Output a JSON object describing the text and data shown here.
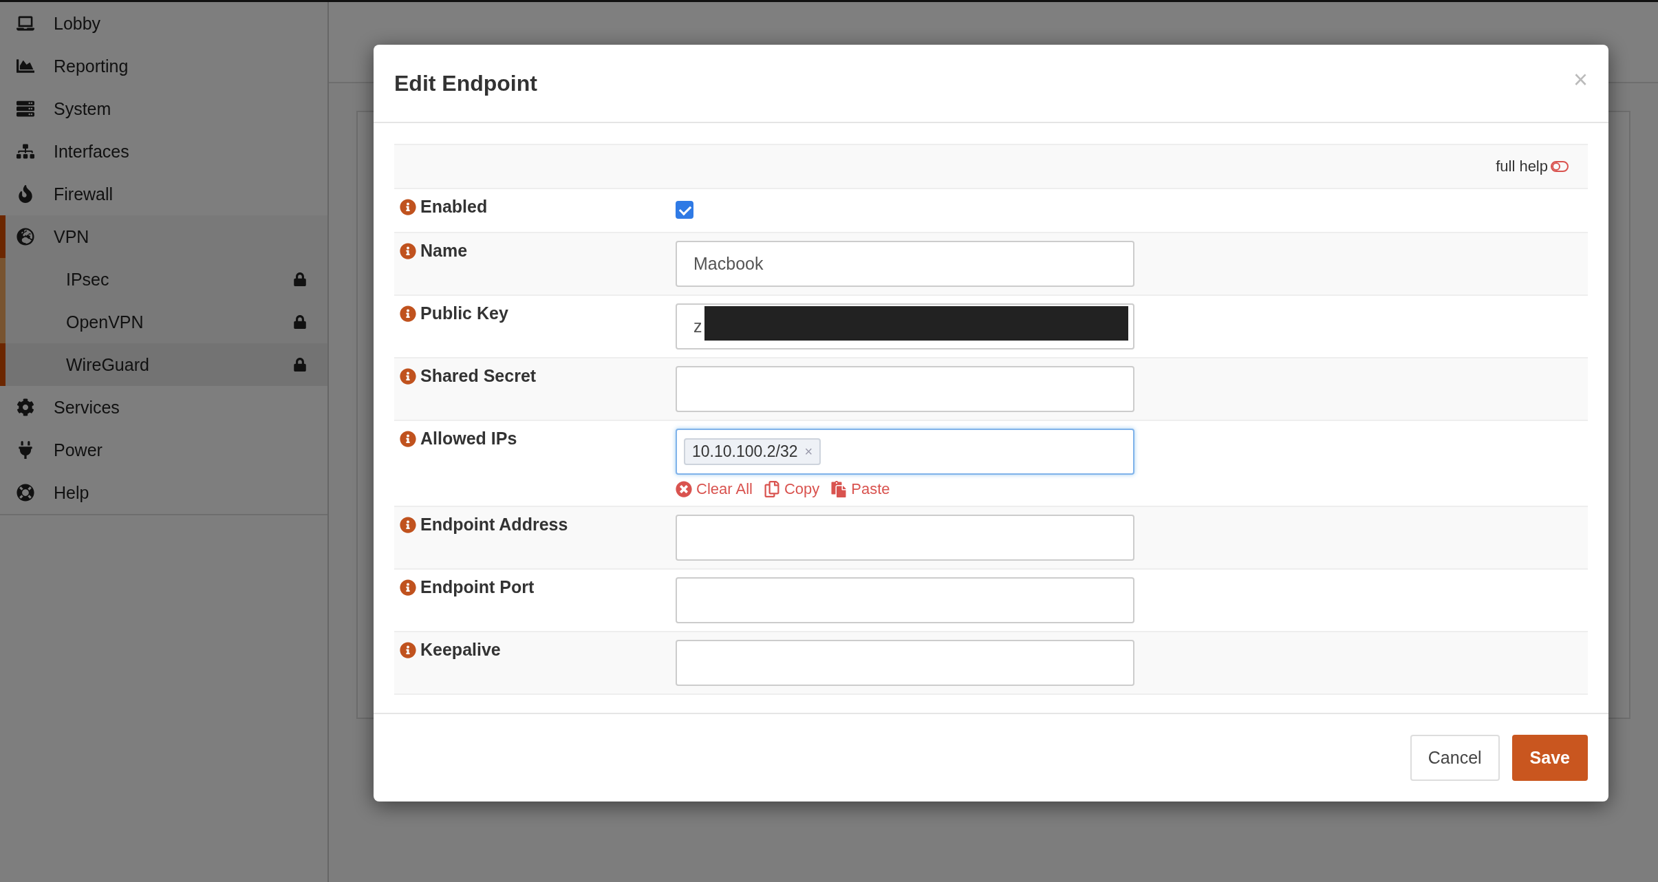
{
  "sidebar": {
    "items": [
      {
        "label": "Lobby",
        "selected": false
      },
      {
        "label": "Reporting",
        "selected": false
      },
      {
        "label": "System",
        "selected": false
      },
      {
        "label": "Interfaces",
        "selected": false
      },
      {
        "label": "Firewall",
        "selected": false
      },
      {
        "label": "VPN",
        "selected": true,
        "expanded": true,
        "children": [
          {
            "label": "IPsec",
            "selected": false
          },
          {
            "label": "OpenVPN",
            "selected": false
          },
          {
            "label": "WireGuard",
            "selected": true
          }
        ]
      },
      {
        "label": "Services",
        "selected": false
      },
      {
        "label": "Power",
        "selected": false
      },
      {
        "label": "Help",
        "selected": false
      }
    ]
  },
  "modal": {
    "title": "Edit Endpoint",
    "close": "×",
    "help_toggle": {
      "label": "full help",
      "on": false
    },
    "fields": [
      {
        "kind": "checkbox",
        "label": "Enabled",
        "checked": true
      },
      {
        "kind": "text",
        "label": "Name",
        "value": "Macbook"
      },
      {
        "kind": "text",
        "label": "Public Key",
        "value": "z",
        "redacted": true
      },
      {
        "kind": "text",
        "label": "Shared Secret"
      },
      {
        "kind": "tags",
        "label": "Allowed IPs",
        "focused": true,
        "tags": [
          {
            "label": "10.10.100.2/32",
            "remove": "×"
          }
        ],
        "actions": [
          "Clear All",
          "Copy",
          "Paste"
        ]
      },
      {
        "kind": "text",
        "label": "Endpoint Address"
      },
      {
        "kind": "text",
        "label": "Endpoint Port"
      },
      {
        "kind": "text",
        "label": "Keepalive"
      }
    ],
    "buttons": [
      {
        "label": "Cancel",
        "kind": "default"
      },
      {
        "label": "Save",
        "kind": "primary"
      }
    ]
  }
}
